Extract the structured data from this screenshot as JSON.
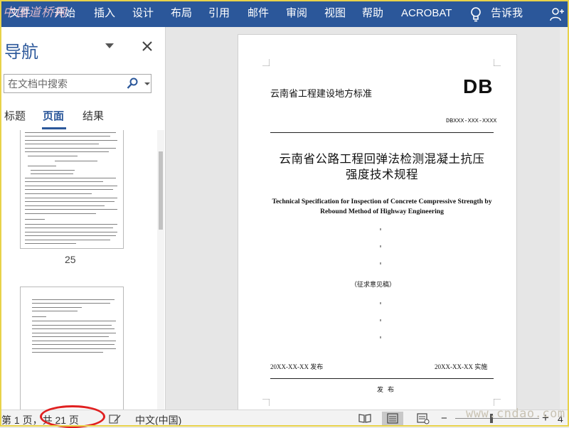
{
  "watermark": "中国道桥网",
  "ribbon": {
    "tabs": [
      "文件",
      "开始",
      "插入",
      "设计",
      "布局",
      "引用",
      "邮件",
      "审阅",
      "视图",
      "帮助",
      "ACROBAT"
    ],
    "tell_me": "告诉我",
    "tell_me_icon": "lightbulb-icon",
    "user_icon": "add-user-icon"
  },
  "nav": {
    "title": "导航",
    "search_placeholder": "在文档中搜索",
    "tabs": [
      "标题",
      "页面",
      "结果"
    ],
    "active_tab": "页面",
    "thumbnail_page_number": "25"
  },
  "document": {
    "header_left": "云南省工程建设地方标准",
    "header_right": "DB",
    "code": "DBXXX-XXX-XXXX",
    "title_line1": "云南省公路工程回弹法检测混凝土抗压",
    "title_line2": "强度技术规程",
    "english_line1": "Technical Specification for Inspection of Concrete Compressive Strength by",
    "english_line2": "Rebound Method of Highway Engineering",
    "draft_label": "（征求意见稿）",
    "issue_date": "20XX-XX-XX 发布",
    "effective_date": "20XX-XX-XX 实施",
    "publish_label": "发布"
  },
  "status": {
    "page_info": "第 1 页，共 21 页",
    "language": "中文(中国)",
    "zoom_minus": "−",
    "zoom_plus": "+",
    "zoom_level": "4",
    "site_watermark": "www.cndao.com"
  }
}
